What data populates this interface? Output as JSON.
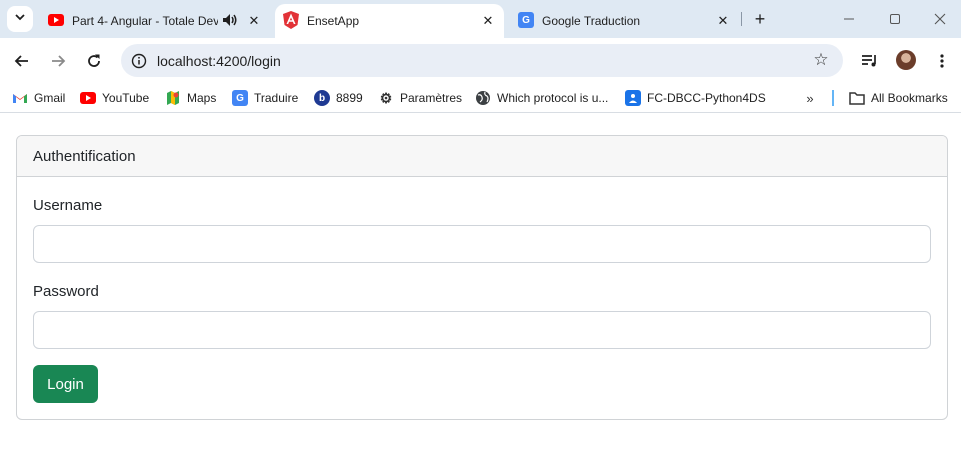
{
  "browser": {
    "tabs": [
      {
        "title": "Part 4- Angular - Totale Dev",
        "icon": "youtube-icon",
        "audio_icon": "speaker-icon"
      },
      {
        "title": "EnsetApp",
        "icon": "angular-icon",
        "active": true
      },
      {
        "title": "Google Traduction",
        "icon": "google-translate-icon"
      }
    ],
    "new_tab": "+",
    "url": "localhost:4200/login",
    "bookmarks": [
      {
        "label": "Gmail",
        "icon": "gmail-icon"
      },
      {
        "label": "YouTube",
        "icon": "youtube-icon"
      },
      {
        "label": "Maps",
        "icon": "maps-icon"
      },
      {
        "label": "Traduire",
        "icon": "translate-icon"
      },
      {
        "label": "8899",
        "icon": "b-icon"
      },
      {
        "label": "Paramètres",
        "icon": "gear-icon"
      },
      {
        "label": "Which protocol is u...",
        "icon": "globe-icon"
      },
      {
        "label": "FC-DBCC-Python4DS",
        "icon": "classroom-icon"
      }
    ],
    "bookmarks_more": "»",
    "all_bookmarks": "All Bookmarks"
  },
  "login": {
    "header": "Authentification",
    "username_label": "Username",
    "username_value": "",
    "password_label": "Password",
    "password_value": "",
    "button_label": "Login"
  },
  "colors": {
    "primary_button": "#198754",
    "tabstrip": "#dfe9f3"
  }
}
